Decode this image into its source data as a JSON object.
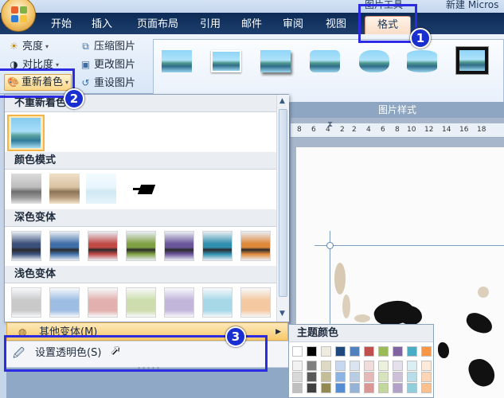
{
  "window": {
    "title_left": "图片工具",
    "title_right": "新建 Micros"
  },
  "tabs": [
    "开始",
    "插入",
    "页面布局",
    "引用",
    "邮件",
    "审阅",
    "视图",
    "格式"
  ],
  "ribbon": {
    "adjust": {
      "brightness": "亮度",
      "contrast": "对比度",
      "recolor": "重新着色",
      "compress": "压缩图片",
      "change": "更改图片",
      "reset": "重设图片"
    },
    "styles_group_label": "图片样式"
  },
  "recolor_menu": {
    "no_recolor_label": "不重新着色",
    "color_modes_label": "颜色模式",
    "dark_variants_label": "深色变体",
    "light_variants_label": "浅色变体",
    "more_variants_label": "其他变体(M)",
    "set_transparent_label": "设置透明色(S)",
    "dark_variant_colors": [
      "#3a4f7a",
      "#3f6fa8",
      "#c14a47",
      "#7fa143",
      "#6a559a",
      "#2f8fae",
      "#e0883a"
    ],
    "light_variant_colors": [
      "#c9c9c9",
      "#9dbde3",
      "#e2b0ae",
      "#cdddad",
      "#c3b6db",
      "#a6d8e8",
      "#f4c9a2"
    ]
  },
  "theme_colors": {
    "title": "主题颜色",
    "row1": [
      "#ffffff",
      "#000000",
      "#eeece1",
      "#1f497d",
      "#4f81bd",
      "#c0504d",
      "#9bbb59",
      "#8064a2",
      "#4bacc6",
      "#f79646"
    ],
    "row2": [
      "#f2f2f2",
      "#7f7f7f",
      "#ddd9c3",
      "#c6d9f0",
      "#dbe5f1",
      "#f2dcdb",
      "#ebf1dd",
      "#e5e0ec",
      "#dbeef3",
      "#fdeada"
    ],
    "row3": [
      "#d8d8d8",
      "#595959",
      "#c4bd97",
      "#8db3e2",
      "#b8cce4",
      "#e5b9b7",
      "#d7e3bc",
      "#ccc1d9",
      "#b7dde8",
      "#fbd5b5"
    ],
    "row4": [
      "#bfbfbf",
      "#3f3f3f",
      "#938953",
      "#548dd4",
      "#95b3d7",
      "#d99694",
      "#c3d69b",
      "#b2a2c7",
      "#92cddc",
      "#fac08f"
    ]
  },
  "ruler_marks": [
    "8",
    "6",
    "4",
    "2",
    "2",
    "4",
    "6",
    "8",
    "10",
    "12",
    "14",
    "16",
    "18"
  ],
  "annotations": [
    "1",
    "2",
    "3"
  ],
  "colors": {
    "callout_blue": "#2c2ce3",
    "tab_bar": "#0c2a55",
    "accent_orange": "#f7c96b"
  }
}
